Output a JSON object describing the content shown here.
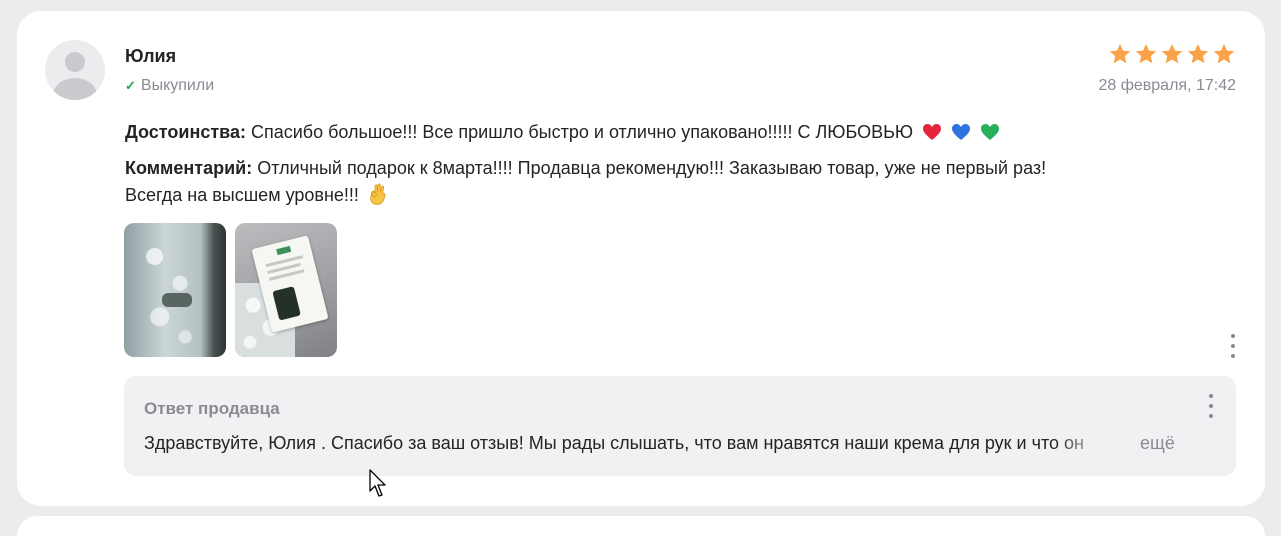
{
  "review": {
    "author": "Юлия",
    "bought_label": "Выкупили",
    "rating": 5,
    "rating_max": 5,
    "date": "28 февраля, 17:42",
    "pros_label": "Достоинства:",
    "pros_text": " Спасибо большое!!! Все пришло быстро и отлично упаковано!!!!! С ЛЮБОВЬЮ",
    "comment_label": "Комментарий:",
    "comment_text_line1": " Отличный подарок к 8марта!!!! Продавца рекомендую!!! Заказываю товар, уже не первый раз!",
    "comment_text_line2": "Всегда на высшем уровне!!!"
  },
  "seller_reply": {
    "title": "Ответ продавца",
    "text": "Здравствуйте, Юлия . Спасибо за ваш отзыв! Мы рады слышать, что вам нравятся наши крема для рук и что он",
    "more_label": "ещё"
  },
  "icons": {
    "check": "check-icon",
    "star": "star-icon",
    "hearts": [
      "red-heart-icon",
      "blue-heart-icon",
      "green-heart-icon"
    ],
    "ok_hand": "ok-hand-icon",
    "more": "more-vertical-icon",
    "cursor": "mouse-cursor-icon"
  },
  "colors": {
    "star": "#f9a247",
    "check": "#17a84b",
    "muted_text": "#8a8a94",
    "text": "#242424",
    "reply_bg": "#f1f1f4"
  }
}
